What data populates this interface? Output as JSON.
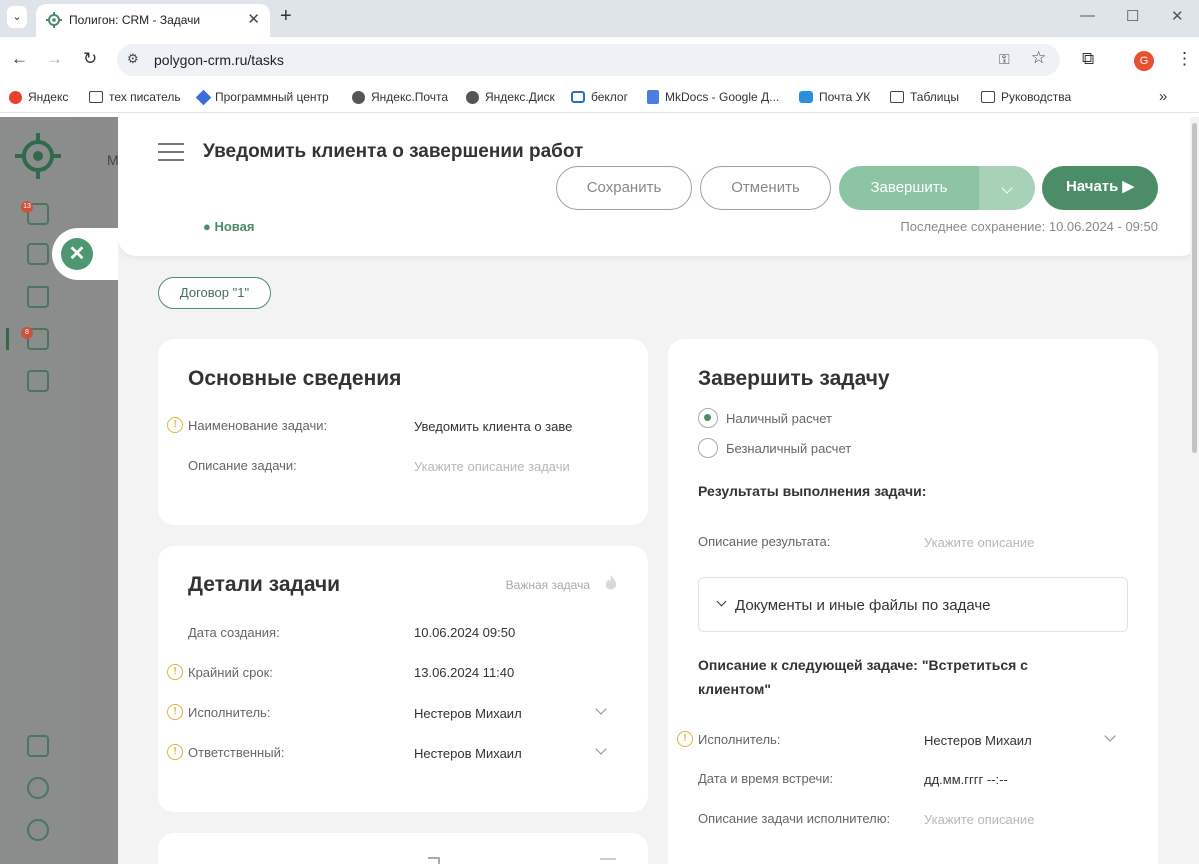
{
  "browser": {
    "tab_title": "Полигон: CRM - Задачи",
    "url": "polygon-crm.ru/tasks",
    "profile_initial": "G",
    "bookmarks": [
      {
        "label": "Яндекс",
        "icon": "yandex-icon"
      },
      {
        "label": "тех писатель",
        "icon": "folder-icon"
      },
      {
        "label": "Программный центр",
        "icon": "app-icon"
      },
      {
        "label": "Яндекс.Почта",
        "icon": "globe-icon"
      },
      {
        "label": "Яндекс.Диск",
        "icon": "globe-icon"
      },
      {
        "label": "беклог",
        "icon": "app-icon"
      },
      {
        "label": "MkDocs - Google Д...",
        "icon": "doc-icon"
      },
      {
        "label": "Почта УК",
        "icon": "mail-icon"
      },
      {
        "label": "Таблицы",
        "icon": "folder-icon"
      },
      {
        "label": "Руководства",
        "icon": "folder-icon"
      }
    ]
  },
  "sidebar": {
    "badges": {
      "tasks_count": "13",
      "check_count": "8"
    },
    "partial_text": "M"
  },
  "header": {
    "title": "Уведомить клиента о завершении работ",
    "save_label": "Сохранить",
    "cancel_label": "Отменить",
    "finish_label": "Завершить",
    "start_label": "Начать ▶",
    "status": "● Новая",
    "last_saved": "Последнее сохранение: 10.06.2024 - 09:50"
  },
  "contract_chip": "Договор \"1\"",
  "main_info": {
    "title": "Основные сведения",
    "name_label": "Наименование задачи:",
    "name_value": "Уведомить клиента о заве",
    "desc_label": "Описание задачи:",
    "desc_placeholder": "Укажите описание задачи"
  },
  "details": {
    "title": "Детали задачи",
    "important_label": "Важная задача",
    "created_label": "Дата создания:",
    "created_value": "10.06.2024 09:50",
    "deadline_label": "Крайний срок:",
    "deadline_value": "13.06.2024 11:40",
    "executor_label": "Исполнитель:",
    "executor_value": "Нестеров Михаил",
    "responsible_label": "Ответственный:",
    "responsible_value": "Нестеров Михаил"
  },
  "complete": {
    "title": "Завершить задачу",
    "payment_cash": "Наличный расчет",
    "payment_cashless": "Безналичный расчет",
    "payment_selected": "cash",
    "results_heading": "Результаты выполнения задачи:",
    "result_desc_label": "Описание результата:",
    "result_desc_placeholder": "Укажите описание",
    "docs_label": "Документы и иные файлы по задаче",
    "next_task_heading": "Описание к следующей задаче: \"Встретиться с клиентом\"",
    "next_executor_label": "Исполнитель:",
    "next_executor_value": "Нестеров Михаил",
    "meeting_label": "Дата и время встречи:",
    "meeting_value": "дд.мм.гггг --:--",
    "exec_desc_label": "Описание задачи исполнителю:",
    "exec_desc_placeholder": "Укажите описание"
  },
  "colors": {
    "accent": "#4b8d67",
    "accent_light": "#8cc4a4",
    "warning": "#e0b33a"
  }
}
